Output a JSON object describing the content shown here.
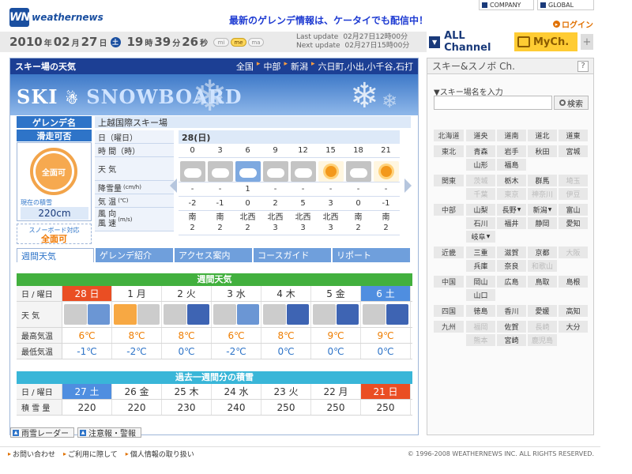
{
  "header": {
    "logo_mark": "WN",
    "logo_text": "weathernews",
    "promo": "最新のゲレンデ情報は、ケータイでも配信中！",
    "company_link": "COMPANY",
    "global_link": "GLOBAL",
    "login": "ログイン"
  },
  "datebar": {
    "year": "2010",
    "year_unit": "年",
    "month": "02",
    "month_unit": "月",
    "day": "27",
    "day_unit": "日",
    "weekday": "土",
    "hour": "19",
    "hour_unit": "時",
    "minute": "39",
    "minute_unit": "分",
    "second": "26",
    "second_unit": "秒",
    "size_buttons": [
      "mi",
      "me",
      "ma"
    ],
    "size_selected": "me",
    "last_update_label": "Last update",
    "last_update_value": "02月27日12時00分",
    "next_update_label": "Next update",
    "next_update_value": "02月27日15時00分"
  },
  "channels": {
    "all_channel": "ALL Channel",
    "my_channel": "MyCh.",
    "plus": "+"
  },
  "main": {
    "title": "スキー場の天気",
    "breadcrumb": [
      "全国",
      "中部",
      "新潟",
      "六日町,小出,小千谷,石打"
    ],
    "hero_logo_1": "SKI",
    "hero_logo_2": "SNOWBOARD",
    "ski_name_label": "ゲレンデ名",
    "ski_name": "上越国際スキー場",
    "open_label": "滑走可否",
    "open_status": "全面可",
    "snow_depth_label": "現在の積雪",
    "snow_depth": "220cm",
    "board_label": "スノーボード対応",
    "board_status": "全面可",
    "forecast_labels": {
      "date": "日（曜日）",
      "time": "時 間（時）",
      "weather": "天 気",
      "snowfall": "降雪量",
      "snowfall_unit": "(cm/h)",
      "temp": "気 温",
      "temp_unit": "(℃)",
      "wind": "風 向\n風 速",
      "wind_unit": "(m/s)"
    },
    "forecast_date": "28(日)",
    "forecast": {
      "hours": [
        "0",
        "3",
        "6",
        "9",
        "12",
        "15",
        "18",
        "21"
      ],
      "weather": [
        "cloud",
        "cloud",
        "snow",
        "cloud",
        "cloud",
        "sun",
        "cloud",
        "sun"
      ],
      "snowfall": [
        "-",
        "-",
        "1",
        "-",
        "-",
        "-",
        "-",
        "-"
      ],
      "temp": [
        "-2",
        "-1",
        "0",
        "2",
        "5",
        "3",
        "0",
        "-1"
      ],
      "wind_dir": [
        "南",
        "南",
        "北西",
        "北西",
        "北西",
        "北西",
        "南",
        "南"
      ],
      "wind_speed": [
        "2",
        "2",
        "2",
        "3",
        "3",
        "3",
        "2",
        "2"
      ]
    },
    "tabs": [
      "週間天気",
      "ゲレンデ紹介",
      "アクセス案内",
      "コースガイド",
      "リポート"
    ],
    "weekly": {
      "title": "週間天気",
      "row_labels": [
        "日 / 曜日",
        "天 気",
        "最高気温",
        "最低気温"
      ],
      "days": [
        "28 日",
        "1 月",
        "2 火",
        "3 水",
        "4 木",
        "5 金",
        "6 土"
      ],
      "day_styles": [
        "red",
        "",
        "",
        "",
        "",
        "",
        "blue"
      ],
      "icons": [
        [
          "c",
          "s"
        ],
        [
          "u",
          "c"
        ],
        [
          "c",
          "n"
        ],
        [
          "c",
          "s"
        ],
        [
          "c",
          "n"
        ],
        [
          "c",
          "n"
        ],
        [
          "c",
          "n"
        ]
      ],
      "highs": [
        "6℃",
        "8℃",
        "8℃",
        "6℃",
        "8℃",
        "9℃",
        "9℃"
      ],
      "lows": [
        "-1℃",
        "-2℃",
        "0℃",
        "-2℃",
        "0℃",
        "0℃",
        "0℃"
      ]
    },
    "past": {
      "title": "過去一週間分の積雪",
      "row_labels": [
        "日 / 曜日",
        "積 雪 量"
      ],
      "days": [
        "27 土",
        "26 金",
        "25 木",
        "24 水",
        "23 火",
        "22 月",
        "21 日"
      ],
      "day_styles": [
        "blue",
        "",
        "",
        "",
        "",
        "",
        "red"
      ],
      "values": [
        "220",
        "220",
        "230",
        "240",
        "250",
        "250",
        "250"
      ]
    },
    "bottom_links": [
      "雨雪レーダー",
      "注意報・警報"
    ]
  },
  "sidebar": {
    "title": "スキー&スノボ Ch.",
    "help": "?",
    "input_label": "▼スキー場名を入力",
    "search_button": "検索",
    "regions": [
      {
        "name": "北海道",
        "prefs": [
          {
            "n": "道央"
          },
          {
            "n": "道南"
          },
          {
            "n": "道北"
          },
          {
            "n": "道東"
          }
        ]
      },
      {
        "name": "東北",
        "prefs": [
          {
            "n": "青森"
          },
          {
            "n": "岩手"
          },
          {
            "n": "秋田"
          },
          {
            "n": "宮城"
          },
          {
            "n": "山形"
          },
          {
            "n": "福島"
          }
        ]
      },
      {
        "name": "関東",
        "prefs": [
          {
            "n": "茨城",
            "off": true
          },
          {
            "n": "栃木"
          },
          {
            "n": "群馬"
          },
          {
            "n": "埼玉",
            "off": true
          },
          {
            "n": "千葉",
            "off": true
          },
          {
            "n": "東京",
            "off": true
          },
          {
            "n": "神奈川",
            "off": true
          },
          {
            "n": "伊豆",
            "off": true
          }
        ]
      },
      {
        "name": "中部",
        "prefs": [
          {
            "n": "山梨"
          },
          {
            "n": "長野",
            "dd": true
          },
          {
            "n": "新潟",
            "dd": true
          },
          {
            "n": "富山"
          },
          {
            "n": "石川"
          },
          {
            "n": "福井"
          },
          {
            "n": "静岡"
          },
          {
            "n": "愛知"
          },
          {
            "n": "岐阜",
            "dd": true
          }
        ]
      },
      {
        "name": "近畿",
        "prefs": [
          {
            "n": "三重"
          },
          {
            "n": "滋賀"
          },
          {
            "n": "京都"
          },
          {
            "n": "大阪",
            "off": true
          },
          {
            "n": "兵庫"
          },
          {
            "n": "奈良"
          },
          {
            "n": "和歌山",
            "off": true
          }
        ]
      },
      {
        "name": "中国",
        "prefs": [
          {
            "n": "岡山"
          },
          {
            "n": "広島"
          },
          {
            "n": "鳥取"
          },
          {
            "n": "島根"
          },
          {
            "n": "山口"
          }
        ]
      },
      {
        "name": "四国",
        "prefs": [
          {
            "n": "徳島"
          },
          {
            "n": "香川"
          },
          {
            "n": "愛媛"
          },
          {
            "n": "高知"
          }
        ]
      },
      {
        "name": "九州",
        "prefs": [
          {
            "n": "福岡",
            "off": true
          },
          {
            "n": "佐賀"
          },
          {
            "n": "長崎",
            "off": true
          },
          {
            "n": "大分"
          },
          {
            "n": "熊本",
            "off": true
          },
          {
            "n": "宮崎"
          },
          {
            "n": "鹿児島",
            "off": true
          }
        ]
      }
    ]
  },
  "footer": {
    "links": [
      "お問い合わせ",
      "ご利用に際して",
      "個人情報の取り扱い"
    ],
    "copyright": "© 1996-2008 WEATHERNEWS INC. ALL RIGHTS RESERVED."
  }
}
